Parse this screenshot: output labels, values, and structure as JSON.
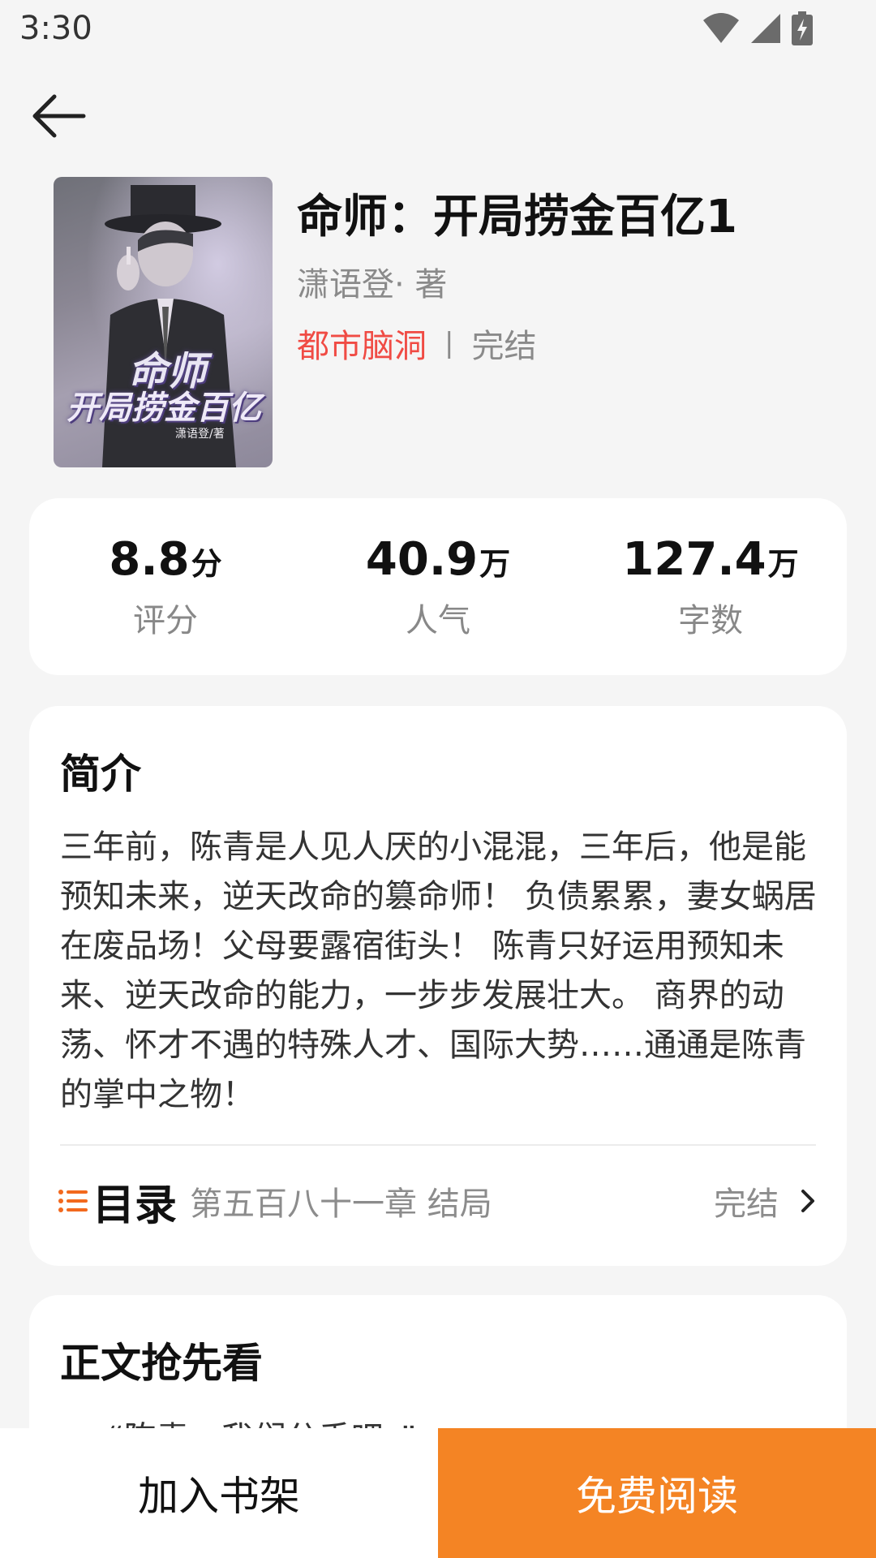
{
  "status_bar": {
    "time": "3:30"
  },
  "book": {
    "title": "命师：开局捞金百亿1",
    "author": "潇语登· 著",
    "genre": "都市脑洞",
    "separator": "|",
    "status": "完结",
    "cover": {
      "title_line1": "命师",
      "title_line2": "开局捞金百亿",
      "author": "潇语登/著"
    }
  },
  "stats": [
    {
      "value": "8.8",
      "unit": "分",
      "label": "评分"
    },
    {
      "value": "40.9",
      "unit": "万",
      "label": "人气"
    },
    {
      "value": "127.4",
      "unit": "万",
      "label": "字数"
    }
  ],
  "intro": {
    "title": "简介",
    "text": "三年前，陈青是人见人厌的小混混，三年后，他是能预知未来，逆天改命的篡命师！ 负债累累，妻女蜗居在废品场！父母要露宿街头！ 陈青只好运用预知未来、逆天改命的能力，一步步发展壮大。 商界的动荡、怀才不遇的特殊人才、国际大势……通通是陈青的掌中之物！"
  },
  "toc": {
    "title": "目录",
    "latest_chapter": "第五百八十一章 结局",
    "status": "完结"
  },
  "preview": {
    "title": "正文抢先看",
    "first_line": "“陈青，我们分手吧。”"
  },
  "bottom_bar": {
    "add_shelf": "加入书架",
    "read_free": "免费阅读"
  },
  "colors": {
    "accent_orange": "#f48424",
    "genre_red": "#f04b44",
    "toc_icon": "#f2691e"
  }
}
